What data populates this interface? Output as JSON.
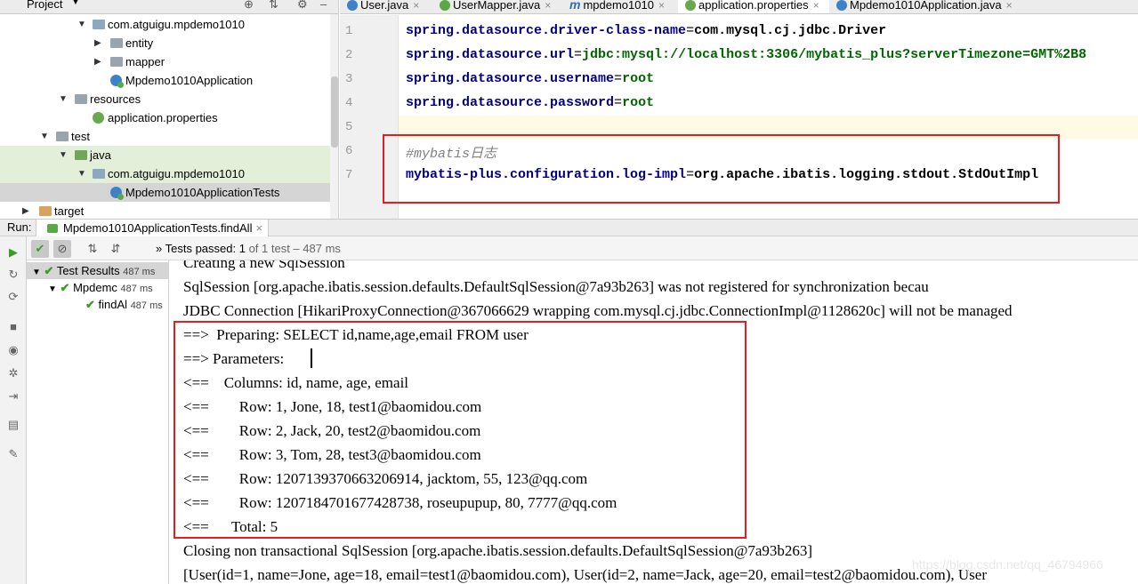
{
  "project_panel": {
    "title": "Project",
    "tree": [
      {
        "label": "com.atguigu.mpdemo1010",
        "icon": "package-icon"
      },
      {
        "label": "entity",
        "icon": "package-icon"
      },
      {
        "label": "mapper",
        "icon": "package-icon"
      },
      {
        "label": "Mpdemo1010Application",
        "icon": "spring-class-icon"
      },
      {
        "label": "resources",
        "icon": "resources-folder-icon"
      },
      {
        "label": "application.properties",
        "icon": "properties-file-icon"
      },
      {
        "label": "test",
        "icon": "folder-icon"
      },
      {
        "label": "java",
        "icon": "test-source-folder-icon"
      },
      {
        "label": "com.atguigu.mpdemo1010",
        "icon": "package-icon"
      },
      {
        "label": "Mpdemo1010ApplicationTests",
        "icon": "spring-class-icon"
      },
      {
        "label": "target",
        "icon": "folder-icon"
      }
    ]
  },
  "editor": {
    "tabs": [
      {
        "label": "User.java",
        "active": false
      },
      {
        "label": "UserMapper.java",
        "active": false
      },
      {
        "label": "mpdemo1010",
        "active": false
      },
      {
        "label": "application.properties",
        "active": true
      },
      {
        "label": "Mpdemo1010Application.java",
        "active": false
      }
    ],
    "line_numbers": [
      "1",
      "2",
      "3",
      "4",
      "5",
      "6",
      "7"
    ],
    "lines": [
      {
        "key": "spring.datasource.driver-class-name",
        "eq": "=",
        "value": "com.mysql.cj.jdbc.Driver"
      },
      {
        "key": "spring.datasource.url",
        "eq": "=",
        "value": "jdbc:mysql://localhost:3306/mybatis_plus?serverTimezone=GMT%2B8"
      },
      {
        "key": "spring.datasource.username",
        "eq": "=",
        "value": "root"
      },
      {
        "key": "spring.datasource.password",
        "eq": "=",
        "value": "root"
      },
      {
        "comment": ""
      },
      {
        "comment": "#mybatis日志"
      },
      {
        "key": "mybatis-plus.configuration.log-impl",
        "eq": "=",
        "value": "org.apache.ibatis.logging.stdout.StdOutImpl"
      }
    ]
  },
  "run": {
    "label": "Run:",
    "tab_label": "Mpdemo1010ApplicationTests.findAll",
    "tab_close": "×",
    "status_prefix": "»",
    "status_bold": "Tests passed: 1",
    "status_rest": " of 1 test – 487 ms",
    "results": [
      {
        "label": "Test Results",
        "time": "487 ms"
      },
      {
        "label": "Mpdemc",
        "time": "487 ms"
      },
      {
        "label": "findAl",
        "time": "487 ms"
      }
    ],
    "console": [
      "Creating a new SqlSession",
      "SqlSession [org.apache.ibatis.session.defaults.DefaultSqlSession@7a93b263] was not registered for synchronization becau",
      "JDBC Connection [HikariProxyConnection@367066629 wrapping com.mysql.cj.jdbc.ConnectionImpl@1128620c] will not be managed",
      "==>  Preparing: SELECT id,name,age,email FROM user",
      "==> Parameters: ",
      "<==    Columns: id, name, age, email",
      "<==        Row: 1, Jone, 18, test1@baomidou.com",
      "<==        Row: 2, Jack, 20, test2@baomidou.com",
      "<==        Row: 3, Tom, 28, test3@baomidou.com",
      "<==        Row: 1207139370663206914, jacktom, 55, 123@qq.com",
      "<==        Row: 1207184701677428738, roseupupup, 80, 7777@qq.com",
      "<==      Total: 5",
      "Closing non transactional SqlSession [org.apache.ibatis.session.defaults.DefaultSqlSession@7a93b263]",
      "[User(id=1, name=Jone, age=18, email=test1@baomidou.com), User(id=2, name=Jack, age=20, email=test2@baomidou.com), User"
    ],
    "watermark": "https://blog.csdn.net/qq_46794966"
  },
  "colors": {
    "highlight_box": "#e02020",
    "pass_green": "#3a9d23",
    "property_key": "#000080",
    "property_value": "#006600"
  }
}
